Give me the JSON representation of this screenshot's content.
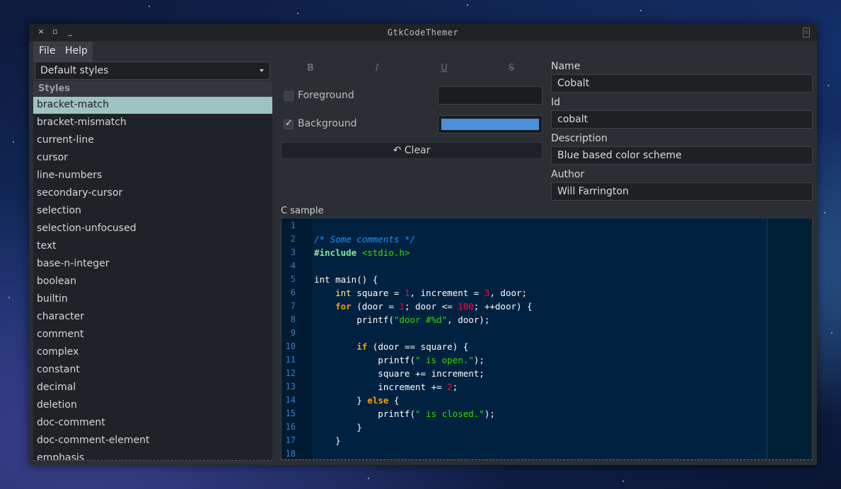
{
  "window": {
    "title": "GtkCodeThemer",
    "buttons": {
      "close": "×",
      "maximize": "▫",
      "minimize": "_"
    }
  },
  "menu": {
    "file": "File",
    "help": "Help"
  },
  "style_scheme_combo": {
    "selected": "Default styles"
  },
  "styles_list": {
    "header": "Styles",
    "selected_index": 0,
    "items": [
      "bracket-match",
      "bracket-mismatch",
      "current-line",
      "cursor",
      "line-numbers",
      "secondary-cursor",
      "selection",
      "selection-unfocused",
      "text",
      "base-n-integer",
      "boolean",
      "builtin",
      "character",
      "comment",
      "complex",
      "constant",
      "decimal",
      "deletion",
      "doc-comment",
      "doc-comment-element",
      "emphasis"
    ]
  },
  "format_buttons": {
    "bold": "B",
    "italic": "I",
    "underline": "U",
    "strikethrough": "S"
  },
  "foreground": {
    "label": "Foreground",
    "checked": false,
    "color": "#1a1c1f"
  },
  "background": {
    "label": "Background",
    "checked": true,
    "color": "#4a90d9"
  },
  "clear_button": {
    "label": "Clear",
    "icon": "undo-icon"
  },
  "scheme": {
    "name_label": "Name",
    "name_value": "Cobalt",
    "id_label": "Id",
    "id_value": "cobalt",
    "description_label": "Description",
    "description_value": "Blue based color scheme",
    "author_label": "Author",
    "author_value": "Will Farrington"
  },
  "sample": {
    "label": "C sample",
    "line_numbers": [
      "1",
      "2",
      "3",
      "4",
      "5",
      "6",
      "7",
      "8",
      "9",
      "10",
      "11",
      "12",
      "13",
      "14",
      "15",
      "16",
      "17",
      "18"
    ],
    "lines": [
      [],
      [
        {
          "t": "/* Some comments */",
          "c": "cm"
        }
      ],
      [
        {
          "t": "#include ",
          "c": "pp"
        },
        {
          "t": "<stdio.h>",
          "c": "ppstr"
        }
      ],
      [],
      [
        {
          "t": "int",
          "c": "fn"
        },
        {
          "t": " main() {",
          "c": "fn"
        }
      ],
      [
        {
          "t": "    ",
          "c": "fn"
        },
        {
          "t": "int",
          "c": "ty"
        },
        {
          "t": " square = ",
          "c": "fn"
        },
        {
          "t": "1",
          "c": "num"
        },
        {
          "t": ", increment = ",
          "c": "fn"
        },
        {
          "t": "3",
          "c": "num"
        },
        {
          "t": ", door;",
          "c": "fn"
        }
      ],
      [
        {
          "t": "    ",
          "c": "fn"
        },
        {
          "t": "for",
          "c": "kw"
        },
        {
          "t": " (door = ",
          "c": "fn"
        },
        {
          "t": "1",
          "c": "num"
        },
        {
          "t": "; door <= ",
          "c": "fn"
        },
        {
          "t": "100",
          "c": "num"
        },
        {
          "t": "; ++door) {",
          "c": "fn"
        }
      ],
      [
        {
          "t": "        printf(",
          "c": "fn"
        },
        {
          "t": "\"door #%d\"",
          "c": "str"
        },
        {
          "t": ", door);",
          "c": "fn"
        }
      ],
      [],
      [
        {
          "t": "        ",
          "c": "fn"
        },
        {
          "t": "if",
          "c": "kw"
        },
        {
          "t": " (door == square) {",
          "c": "fn"
        }
      ],
      [
        {
          "t": "            printf(",
          "c": "fn"
        },
        {
          "t": "\" is open.\"",
          "c": "str"
        },
        {
          "t": ");",
          "c": "fn"
        }
      ],
      [
        {
          "t": "            square += increment;",
          "c": "fn"
        }
      ],
      [
        {
          "t": "            increment += ",
          "c": "fn"
        },
        {
          "t": "2",
          "c": "num"
        },
        {
          "t": ";",
          "c": "fn"
        }
      ],
      [
        {
          "t": "        } ",
          "c": "fn"
        },
        {
          "t": "else",
          "c": "kw"
        },
        {
          "t": " {",
          "c": "fn"
        }
      ],
      [
        {
          "t": "            printf(",
          "c": "fn"
        },
        {
          "t": "\" is closed.\"",
          "c": "str"
        },
        {
          "t": ");",
          "c": "fn"
        }
      ],
      [
        {
          "t": "        }",
          "c": "fn"
        }
      ],
      [
        {
          "t": "    }",
          "c": "fn"
        }
      ],
      []
    ]
  }
}
